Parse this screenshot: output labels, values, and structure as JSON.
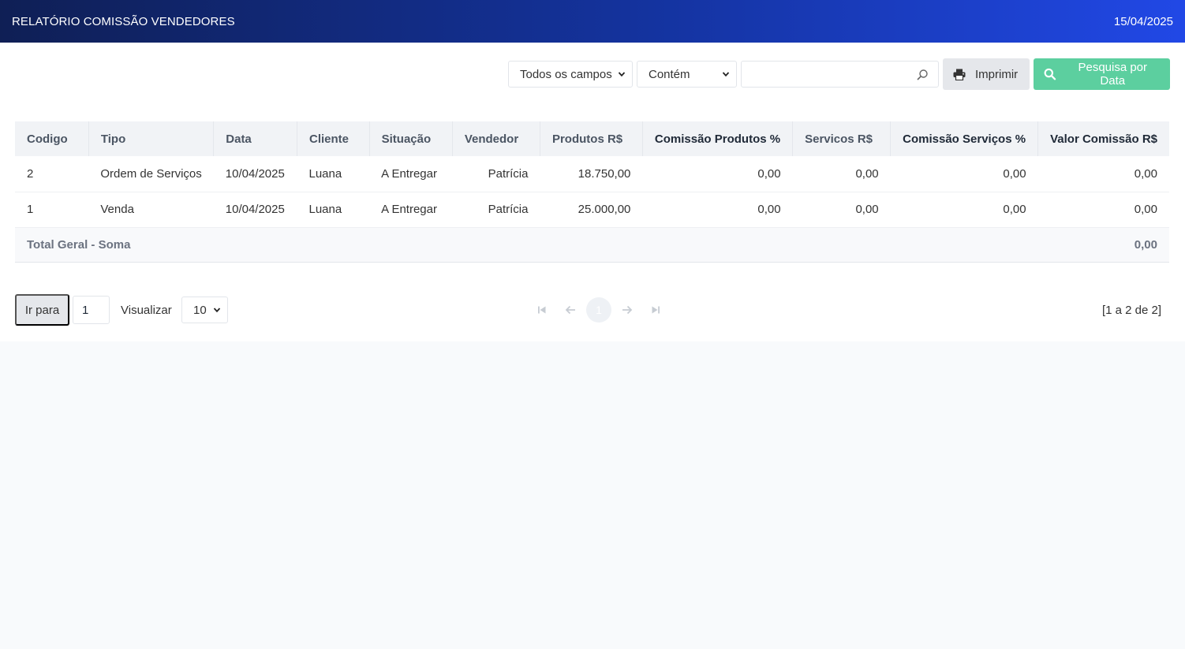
{
  "header": {
    "title": "RELATÓRIO COMISSÃO VENDEDORES",
    "date": "15/04/2025"
  },
  "toolbar": {
    "field_select": "Todos os campos",
    "operator_select": "Contém",
    "search_value": "",
    "print_label": "Imprimir",
    "date_search_label": "Pesquisa por Data"
  },
  "table": {
    "columns": [
      "Codigo",
      "Tipo",
      "Data",
      "Cliente",
      "Situação",
      "Vendedor",
      "Produtos R$",
      "Comissão Produtos %",
      "Servicos R$",
      "Comissão Serviços %",
      "Valor Comissão R$"
    ],
    "rows": [
      [
        "2",
        "Ordem de Serviços",
        "10/04/2025",
        "Luana",
        "A Entregar",
        "Patrícia",
        "18.750,00",
        "0,00",
        "0,00",
        "0,00",
        "0,00"
      ],
      [
        "1",
        "Venda",
        "10/04/2025",
        "Luana",
        "A Entregar",
        "Patrícia",
        "25.000,00",
        "0,00",
        "0,00",
        "0,00",
        "0,00"
      ]
    ],
    "total_label": "Total Geral - Soma",
    "total_value": "0,00"
  },
  "pager": {
    "goto_label": "Ir para",
    "goto_value": "1",
    "view_label": "Visualizar",
    "page_size": "10",
    "current_page": "1",
    "info": "[1 a 2 de 2]"
  },
  "colors": {
    "header_start": "#0f1f55",
    "header_end": "#2148e6",
    "date_button": "#5ccf9f"
  }
}
